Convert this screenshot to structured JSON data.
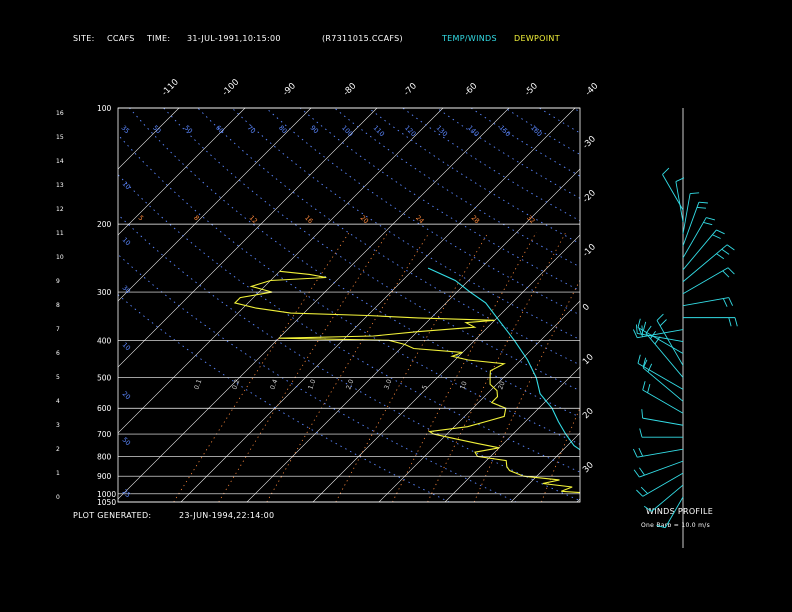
{
  "header": {
    "site_label": "SITE:",
    "site_value": "CCAFS",
    "time_label": "TIME:",
    "time_value": "31-JUL-1991,10:15:00",
    "file_id": "(R7311015.CCAFS)",
    "legend_temp_winds": "TEMP/WINDS",
    "legend_dewpoint": "DEWPOINT"
  },
  "footer": {
    "generated_label": "PLOT GENERATED:",
    "generated_value": "23-JUN-1994,22:14:00"
  },
  "winds_panel": {
    "title": "WINDS PROFILE",
    "note": "One Barb = 10.0 m/s"
  },
  "colors": {
    "background": "#000000",
    "grid": "#ffffff",
    "temp_winds": "#33dde6",
    "dewpoint": "#f2f23a",
    "dry_adiabat": "#5b87ff",
    "mixing_ratio": "#ff8a3d",
    "text": "#ffffff"
  },
  "chart_data": {
    "type": "line",
    "title": "",
    "xlabel": "",
    "ylabel": "",
    "chart_kind": "skew-T log-p thermodynamic diagram",
    "pressure_levels_mb": [
      "100",
      "200",
      "300",
      "400",
      "500",
      "600",
      "700",
      "800",
      "900",
      "1000",
      "1050"
    ],
    "height_km_labels": [
      "16",
      "15",
      "14",
      "13",
      "12",
      "11",
      "10",
      "9",
      "8",
      "7",
      "6",
      "5",
      "4",
      "3",
      "2",
      "1",
      "0"
    ],
    "isotherm_top_labels": [
      "-110",
      "-100",
      "-90",
      "-80",
      "-70",
      "-60",
      "-50",
      "-40"
    ],
    "isotherm_right_labels": [
      "-30",
      "-20",
      "-10",
      "0",
      "10",
      "20",
      "30"
    ],
    "potential_temp_labels": [
      "35",
      "50",
      "50",
      "60",
      "70",
      "80",
      "90",
      "100",
      "110",
      "120",
      "130",
      "140",
      "150",
      "160"
    ],
    "potential_temp_left_labels": [
      "10",
      "10",
      "30",
      "10",
      "20",
      "50",
      "25"
    ],
    "mixing_ratio_top_labels": [
      "5",
      "8",
      "12",
      "16",
      "20",
      "24",
      "28",
      "32"
    ],
    "mixing_ratio_mid_labels": [
      "0.1",
      "0.2",
      "0.4",
      "1.0",
      "2.0",
      "3.0",
      "5",
      "10",
      "20"
    ],
    "series": [
      {
        "name": "TEMP/WINDS",
        "points": [
          {
            "p": 1000,
            "t": 30
          },
          {
            "p": 980,
            "t": 27
          },
          {
            "p": 950,
            "t": 24
          },
          {
            "p": 920,
            "t": 22
          },
          {
            "p": 900,
            "t": 21
          },
          {
            "p": 850,
            "t": 18
          },
          {
            "p": 800,
            "t": 15
          },
          {
            "p": 750,
            "t": 11
          },
          {
            "p": 700,
            "t": 8
          },
          {
            "p": 650,
            "t": 5
          },
          {
            "p": 600,
            "t": 2
          },
          {
            "p": 550,
            "t": -2
          },
          {
            "p": 500,
            "t": -5
          },
          {
            "p": 450,
            "t": -9
          },
          {
            "p": 400,
            "t": -14
          },
          {
            "p": 350,
            "t": -20
          },
          {
            "p": 320,
            "t": -24
          },
          {
            "p": 300,
            "t": -28
          },
          {
            "p": 280,
            "t": -32
          },
          {
            "p": 260,
            "t": -38
          }
        ]
      },
      {
        "name": "DEWPOINT",
        "points": [
          {
            "p": 1000,
            "t": 22
          },
          {
            "p": 985,
            "t": 16
          },
          {
            "p": 960,
            "t": 17
          },
          {
            "p": 940,
            "t": 12
          },
          {
            "p": 920,
            "t": 14
          },
          {
            "p": 900,
            "t": 8
          },
          {
            "p": 870,
            "t": 5
          },
          {
            "p": 850,
            "t": 4
          },
          {
            "p": 820,
            "t": 3
          },
          {
            "p": 800,
            "t": -2
          },
          {
            "p": 780,
            "t": -3
          },
          {
            "p": 760,
            "t": 0
          },
          {
            "p": 740,
            "t": -4
          },
          {
            "p": 720,
            "t": -8
          },
          {
            "p": 700,
            "t": -12
          },
          {
            "p": 690,
            "t": -13
          },
          {
            "p": 670,
            "t": -8
          },
          {
            "p": 650,
            "t": -6
          },
          {
            "p": 630,
            "t": -4
          },
          {
            "p": 600,
            "t": -5
          },
          {
            "p": 580,
            "t": -8
          },
          {
            "p": 560,
            "t": -8
          },
          {
            "p": 540,
            "t": -9
          },
          {
            "p": 520,
            "t": -11
          },
          {
            "p": 500,
            "t": -12
          },
          {
            "p": 480,
            "t": -13
          },
          {
            "p": 460,
            "t": -12
          },
          {
            "p": 450,
            "t": -18
          },
          {
            "p": 440,
            "t": -21
          },
          {
            "p": 430,
            "t": -20
          },
          {
            "p": 420,
            "t": -28
          },
          {
            "p": 410,
            "t": -30
          },
          {
            "p": 400,
            "t": -33
          },
          {
            "p": 395,
            "t": -50
          },
          {
            "p": 390,
            "t": -36
          },
          {
            "p": 380,
            "t": -30
          },
          {
            "p": 370,
            "t": -22
          },
          {
            "p": 360,
            "t": -24
          },
          {
            "p": 355,
            "t": -20
          },
          {
            "p": 350,
            "t": -32
          },
          {
            "p": 345,
            "t": -40
          },
          {
            "p": 340,
            "t": -52
          },
          {
            "p": 330,
            "t": -58
          },
          {
            "p": 320,
            "t": -62
          },
          {
            "p": 310,
            "t": -62
          },
          {
            "p": 300,
            "t": -58
          },
          {
            "p": 290,
            "t": -62
          },
          {
            "p": 280,
            "t": -60
          },
          {
            "p": 275,
            "t": -52
          },
          {
            "p": 270,
            "t": -55
          },
          {
            "p": 265,
            "t": -60
          }
        ]
      }
    ],
    "winds": [
      {
        "h": 0.0,
        "dir": 210,
        "spd": 5
      },
      {
        "h": 0.5,
        "dir": 230,
        "spd": 10
      },
      {
        "h": 1.0,
        "dir": 240,
        "spd": 15
      },
      {
        "h": 1.5,
        "dir": 250,
        "spd": 15
      },
      {
        "h": 2.0,
        "dir": 260,
        "spd": 15
      },
      {
        "h": 2.5,
        "dir": 270,
        "spd": 10
      },
      {
        "h": 3.0,
        "dir": 280,
        "spd": 10
      },
      {
        "h": 3.5,
        "dir": 300,
        "spd": 15
      },
      {
        "h": 4.0,
        "dir": 310,
        "spd": 20
      },
      {
        "h": 4.5,
        "dir": 300,
        "spd": 20
      },
      {
        "h": 5.0,
        "dir": 320,
        "spd": 25
      },
      {
        "h": 5.5,
        "dir": 330,
        "spd": 20
      },
      {
        "h": 6.0,
        "dir": 300,
        "spd": 20
      },
      {
        "h": 6.5,
        "dir": 280,
        "spd": 15
      },
      {
        "h": 7.0,
        "dir": 260,
        "spd": 15
      },
      {
        "h": 7.5,
        "dir": 90,
        "spd": 20
      },
      {
        "h": 8.0,
        "dir": 80,
        "spd": 15
      },
      {
        "h": 8.5,
        "dir": 60,
        "spd": 20
      },
      {
        "h": 9.0,
        "dir": 50,
        "spd": 25
      },
      {
        "h": 9.5,
        "dir": 40,
        "spd": 20
      },
      {
        "h": 10.0,
        "dir": 30,
        "spd": 15
      },
      {
        "h": 10.5,
        "dir": 20,
        "spd": 15
      },
      {
        "h": 11.0,
        "dir": 10,
        "spd": 10
      },
      {
        "h": 11.5,
        "dir": 350,
        "spd": 10
      },
      {
        "h": 12.0,
        "dir": 330,
        "spd": 10
      }
    ]
  }
}
